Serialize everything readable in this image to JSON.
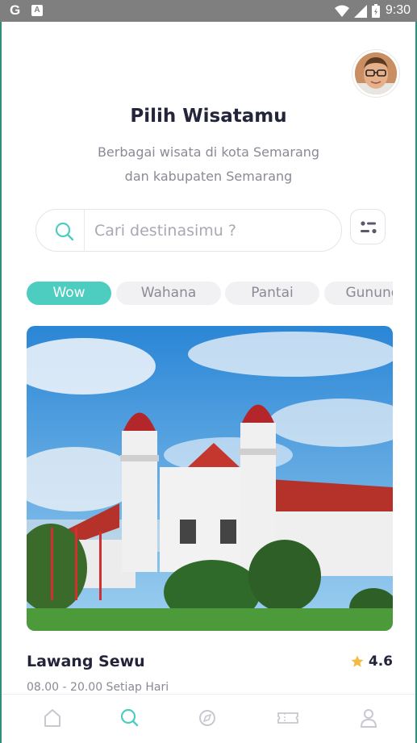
{
  "status_bar": {
    "left_glyph": "G",
    "notification_glyph": "A",
    "time": "9:30",
    "icons": [
      "wifi-icon",
      "signal-icon",
      "battery-icon"
    ]
  },
  "header": {
    "title": "Pilih Wisatamu",
    "subtitle_line1": "Berbagai wisata di kota Semarang",
    "subtitle_line2": "dan kabupaten Semarang"
  },
  "search": {
    "placeholder": "Cari destinasimu ?",
    "value": ""
  },
  "categories": [
    {
      "label": "Wow",
      "active": true
    },
    {
      "label": "Wahana",
      "active": false
    },
    {
      "label": "Pantai",
      "active": false
    },
    {
      "label": "Gunung",
      "active": false
    }
  ],
  "featured": {
    "name": "Lawang Sewu",
    "rating": "4.6",
    "hours": "08.00 - 20.00 Setiap Hari"
  },
  "bottom_nav": [
    {
      "icon": "home-icon",
      "active": false
    },
    {
      "icon": "search-icon",
      "active": true
    },
    {
      "icon": "compass-icon",
      "active": false
    },
    {
      "icon": "ticket-icon",
      "active": false
    },
    {
      "icon": "profile-icon",
      "active": false
    }
  ],
  "colors": {
    "accent": "#4dcdc0",
    "star": "#f4b942",
    "nav_inactive": "#c8c8d0",
    "frame": "#2f8f7b"
  }
}
